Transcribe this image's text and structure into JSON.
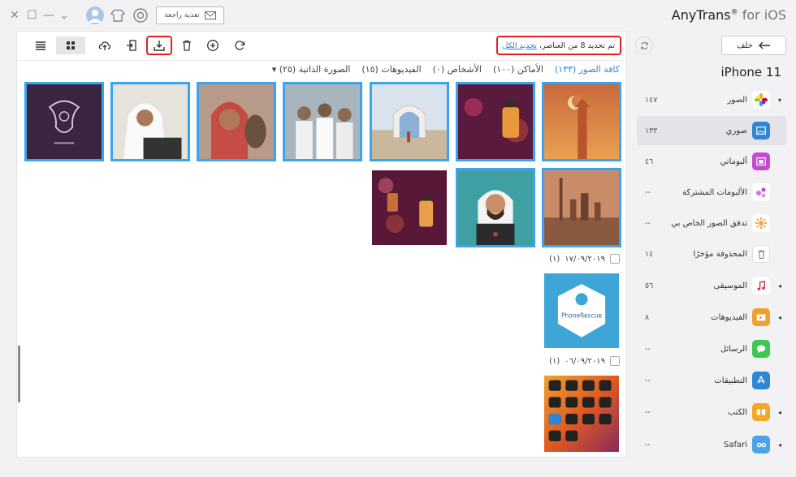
{
  "titlebar": {
    "feedback_label": "تغذية راجعة",
    "app_name": "AnyTrans",
    "reg_mark": "®",
    "for_os": " for iOS"
  },
  "toolbar": {
    "selection_status": "تم تحديد 8 من العناصر،",
    "select_all": "تحديد الكل"
  },
  "filters": [
    {
      "label": "كافة الصور (١٣٣)",
      "active": true
    },
    {
      "label": "الأماكن (١٠٠)",
      "active": false
    },
    {
      "label": "الأشخاص (٠)",
      "active": false
    },
    {
      "label": "الفيديوهات (١٥)",
      "active": false
    },
    {
      "label": "الصورة الذاتية (٢٥) ▾",
      "active": false
    }
  ],
  "date_groups": [
    {
      "date": "١٧/٠٩/٢٠١٩",
      "count": "(١)"
    },
    {
      "date": "٠٦/٠٩/٢٠١٩",
      "count": "(١)"
    }
  ],
  "thumbs": {
    "phonerescue_label": "PhoneRescue"
  },
  "sidebar": {
    "back_label": "خلف",
    "device_name": "iPhone 11",
    "items": [
      {
        "label": "الصور",
        "count": "١٤٧",
        "icon": "photos-icon",
        "color": "#ffffff",
        "arrow": "▾"
      },
      {
        "label": "صوري",
        "count": "١٣٣",
        "icon": "my-photos-icon",
        "color": "#2f86d6",
        "arrow": ""
      },
      {
        "label": "ألبوماتي",
        "count": "٤٦",
        "icon": "albums-icon",
        "color": "#c44bd0",
        "arrow": ""
      },
      {
        "label": "الألبومات المشتركة",
        "count": "--",
        "icon": "shared-albums-icon",
        "color": "#ffffff",
        "arrow": ""
      },
      {
        "label": "تدفق الصور الخاص بي",
        "count": "--",
        "icon": "photo-stream-icon",
        "color": "#ffffff",
        "arrow": ""
      },
      {
        "label": "المحذوفة مؤخرًا",
        "count": "١٤",
        "icon": "trash-icon",
        "color": "#ffffff",
        "arrow": ""
      },
      {
        "label": "الموسيقى",
        "count": "٥٦",
        "icon": "music-icon",
        "color": "#ffffff",
        "arrow": "◂"
      },
      {
        "label": "الفيديوهات",
        "count": "٨",
        "icon": "videos-icon",
        "color": "#f0a030",
        "arrow": "◂"
      },
      {
        "label": "الرسائل",
        "count": "--",
        "icon": "messages-icon",
        "color": "#3cc850",
        "arrow": ""
      },
      {
        "label": "التطبيقات",
        "count": "--",
        "icon": "apps-icon",
        "color": "#2f86d6",
        "arrow": ""
      },
      {
        "label": "الكتب",
        "count": "--",
        "icon": "books-icon",
        "color": "#f5a623",
        "arrow": "◂"
      },
      {
        "label": "Safari",
        "count": "--",
        "icon": "safari-icon",
        "color": "#4aa3e8",
        "arrow": "◂"
      }
    ]
  }
}
